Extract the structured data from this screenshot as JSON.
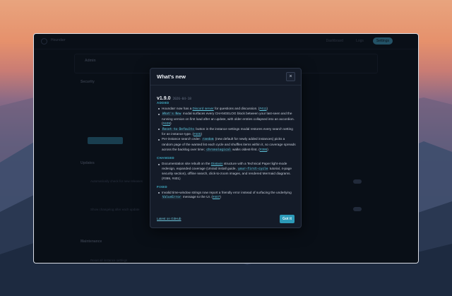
{
  "background_app": {
    "name": "Houndarr",
    "nav": [
      "Dashboard",
      "Logs",
      "Settings"
    ],
    "card_title": "Admin",
    "sections": [
      "Security",
      "Updates",
      "Maintenance"
    ],
    "button_label": "Update Password",
    "row_1": "Automatically check for new releases",
    "row_2": "Show changelog after each update",
    "row_3": "Reset all instance settings"
  },
  "modal": {
    "title": "What's new",
    "close_label": "×",
    "version": "v1.9.0",
    "date": "2026-04-18",
    "sections": [
      {
        "label": "ADDED",
        "entries": [
          {
            "parts": [
              {
                "t": "text",
                "v": "Houndarr now has a "
              },
              {
                "t": "link",
                "v": "Discord server"
              },
              {
                "t": "text",
                "v": " for questions and discussion. ("
              },
              {
                "t": "link",
                "v": "#411"
              },
              {
                "t": "text",
                "v": ")"
              }
            ]
          },
          {
            "parts": [
              {
                "t": "code",
                "v": "What's New"
              },
              {
                "t": "text",
                "v": " modal surfaces every CHANGELOG block between your last-seen and the running version on first load after an update, with older entries collapsed into an accordion. ("
              },
              {
                "t": "link",
                "v": "#409"
              },
              {
                "t": "text",
                "v": ")"
              }
            ]
          },
          {
            "parts": [
              {
                "t": "code",
                "v": "Reset to Defaults"
              },
              {
                "t": "text",
                "v": " button in the instance settings modal restores every search setting for an instance type. ("
              },
              {
                "t": "link",
                "v": "#405"
              },
              {
                "t": "text",
                "v": ")"
              }
            ]
          },
          {
            "parts": [
              {
                "t": "text",
                "v": "Per-instance search order: "
              },
              {
                "t": "code",
                "v": "random"
              },
              {
                "t": "text",
                "v": " (new default for newly added instances) picks a random page of the wanted list each cycle and shuffles items within it, so coverage spreads across the backlog over time; "
              },
              {
                "t": "code",
                "v": "chronological"
              },
              {
                "t": "text",
                "v": " walks oldest-first. ("
              },
              {
                "t": "link",
                "v": "#395"
              },
              {
                "t": "text",
                "v": ")"
              }
            ]
          }
        ]
      },
      {
        "label": "CHANGED",
        "entries": [
          {
            "parts": [
              {
                "t": "text",
                "v": "Documentation site rebuilt on the "
              },
              {
                "t": "link",
                "v": "Diataxis"
              },
              {
                "t": "text",
                "v": " structure with a Technical Paper light-mode redesign, expanded coverage (Unraid install guide, "
              },
              {
                "t": "code",
                "v": "your-first-cycle"
              },
              {
                "t": "text",
                "v": " tutorial, 4-page security section), offline search, click-to-zoom images, and rendered Mermaid diagrams. (#399, #401)"
              }
            ]
          }
        ]
      },
      {
        "label": "FIXED",
        "entries": [
          {
            "parts": [
              {
                "t": "text",
                "v": "Invalid time-window strings now report a friendly error instead of surfacing the underlying "
              },
              {
                "t": "code",
                "v": "ValueError"
              },
              {
                "t": "text",
                "v": " message to the UI. ("
              },
              {
                "t": "link",
                "v": "#407"
              },
              {
                "t": "text",
                "v": ")"
              }
            ]
          }
        ]
      }
    ],
    "footer_link": "Latest on GitHub",
    "primary_button": "Got it"
  },
  "colors": {
    "accent": "#3fb0c9",
    "button": "#2c9ab8",
    "modal_bg": "#141b28"
  }
}
